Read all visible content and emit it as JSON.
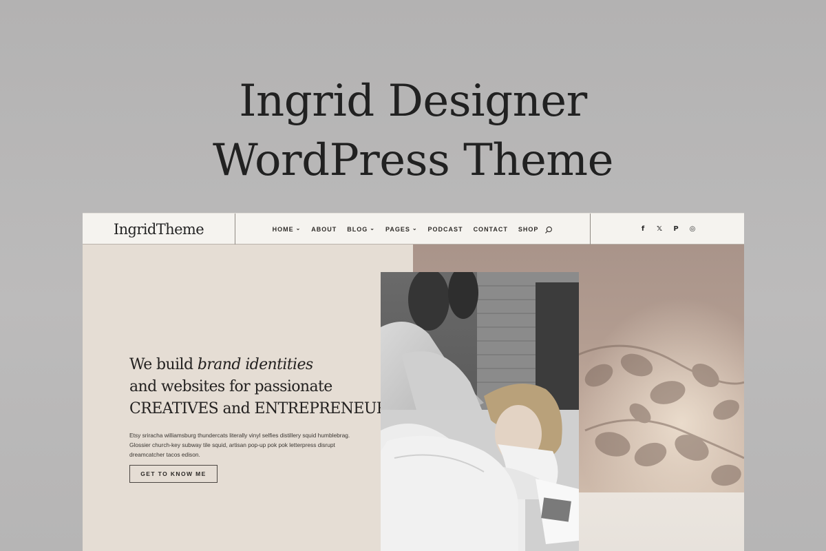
{
  "promo": {
    "title_line1": "Ingrid Designer",
    "title_line2": "WordPress Theme"
  },
  "header": {
    "logo": "IngridTheme",
    "nav": [
      {
        "label": "HOME",
        "dropdown": true
      },
      {
        "label": "ABOUT",
        "dropdown": false
      },
      {
        "label": "BLOG",
        "dropdown": true
      },
      {
        "label": "PAGES",
        "dropdown": true
      },
      {
        "label": "PODCAST",
        "dropdown": false
      },
      {
        "label": "CONTACT",
        "dropdown": false
      },
      {
        "label": "SHOP",
        "dropdown": false
      }
    ],
    "chevron": "⌄",
    "social": [
      {
        "icon": "facebook-icon",
        "glyph": "f"
      },
      {
        "icon": "x-icon",
        "glyph": "𝕏"
      },
      {
        "icon": "pinterest-icon",
        "glyph": "P"
      },
      {
        "icon": "instagram-icon",
        "glyph": "◎"
      }
    ]
  },
  "hero": {
    "headline_1a": "We build ",
    "headline_1b": "brand identities",
    "headline_2": "and websites for passionate",
    "headline_3": "CREATIVES and ENTREPRENEURS",
    "body": "Etsy sriracha williamsburg thundercats literally vinyl selfies distillery squid humblebrag. Glossier church-key subway tile squid, artisan pop-up pok pok letterpress disrupt dreamcatcher tacos edison.",
    "cta": "GET TO KNOW ME"
  },
  "colors": {
    "background": "#b8b7b7",
    "hero_panel": "#e5ddd4",
    "header": "#f5f3ef",
    "text": "#232120"
  }
}
